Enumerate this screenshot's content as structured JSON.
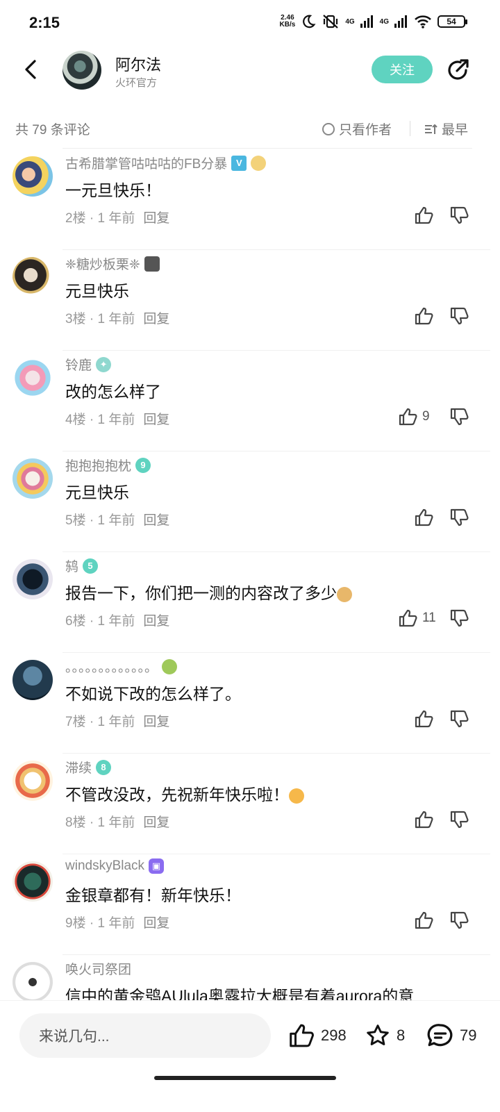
{
  "status": {
    "time": "2:15",
    "speed_top": "2.46",
    "speed_bottom": "KB/s",
    "net1": "4G",
    "net2": "4G",
    "battery": "54"
  },
  "header": {
    "name": "阿尔法",
    "subtitle": "火环官方",
    "follow_label": "关注"
  },
  "subbar": {
    "count": "共 79 条评论",
    "only_author": "只看作者",
    "sort": "最早"
  },
  "comments": [
    {
      "name": "古希腊掌管咕咕咕的FB分暴",
      "text": "一元旦快乐！",
      "floor": "2楼",
      "time": "1 年前",
      "reply": "回复",
      "likes": ""
    },
    {
      "name": "❈糖炒板栗❈",
      "text": "元旦快乐",
      "floor": "3楼",
      "time": "1 年前",
      "reply": "回复",
      "likes": ""
    },
    {
      "name": "铃鹿",
      "text": "改的怎么样了",
      "floor": "4楼",
      "time": "1 年前",
      "reply": "回复",
      "likes": "9"
    },
    {
      "name": "抱抱抱抱枕",
      "text": "元旦快乐",
      "floor": "5楼",
      "time": "1 年前",
      "reply": "回复",
      "likes": "",
      "badge": "9"
    },
    {
      "name": "鸫",
      "text": "报告一下，你们把一测的内容改了多少",
      "floor": "6楼",
      "time": "1 年前",
      "reply": "回复",
      "likes": "11",
      "badge": "5"
    },
    {
      "name": "。。。。。。。。。。。。。",
      "text": "不如说下改的怎么样了。",
      "floor": "7楼",
      "time": "1 年前",
      "reply": "回复",
      "likes": ""
    },
    {
      "name": "滞续",
      "text": "不管改没改，先祝新年快乐啦！",
      "floor": "8楼",
      "time": "1 年前",
      "reply": "回复",
      "likes": "",
      "badge": "8"
    },
    {
      "name": "windskyBlack",
      "text": "金银章都有！新年快乐！",
      "floor": "9楼",
      "time": "1 年前",
      "reply": "回复",
      "likes": ""
    },
    {
      "name": "唤火司祭团",
      "text": "信中的黄金鸮AUlula奥露拉大概是有着aurora的意",
      "floor": "",
      "time": "",
      "reply": "",
      "likes": ""
    }
  ],
  "bottom": {
    "placeholder": "来说几句...",
    "likes": "298",
    "stars": "8",
    "comments": "79"
  },
  "colors": {
    "accent": "#5fd3c0",
    "text_secondary": "#888888"
  }
}
